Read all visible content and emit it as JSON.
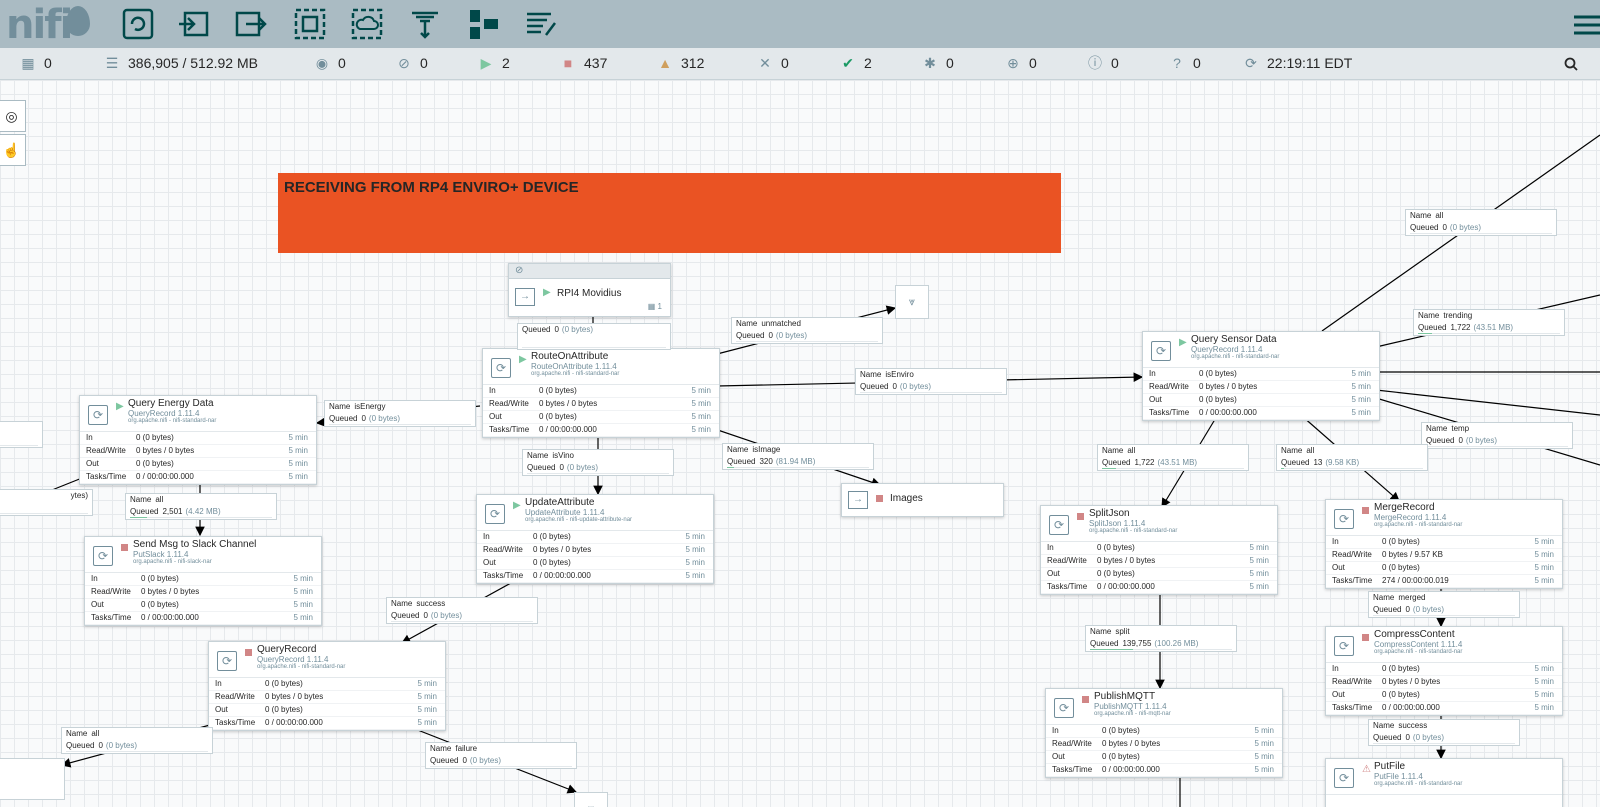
{
  "app": {
    "logo": "nifi"
  },
  "toolbar": {
    "items": [
      {
        "icon": "processor-icon"
      },
      {
        "icon": "input-port-icon"
      },
      {
        "icon": "output-port-icon"
      },
      {
        "icon": "process-group-icon"
      },
      {
        "icon": "remote-process-group-icon"
      },
      {
        "icon": "funnel-icon"
      },
      {
        "icon": "template-icon"
      },
      {
        "icon": "label-icon"
      }
    ]
  },
  "status": {
    "transmitting": "0",
    "queued": "386,905 / 512.92 MB",
    "transmitting_rpg": "0",
    "not_transmitting_rpg": "0",
    "running": "2",
    "stopped": "437",
    "invalid": "312",
    "disabled": "0",
    "up_to_date": "2",
    "locally_modified": "0",
    "stale": "0",
    "locally_modified_stale": "0",
    "sync_failure": "0",
    "refreshed": "22:19:11 EDT"
  },
  "label": {
    "text": "RECEIVING FROM RP4 ENVIRO+ DEVICE"
  },
  "process_group": {
    "name": "RPI4 Movidius",
    "count": "1"
  },
  "output_port": {
    "name": "Images"
  },
  "stats_labels": {
    "in": "In",
    "rw": "Read/Write",
    "out": "Out",
    "tasks": "Tasks/Time",
    "window": "5 min"
  },
  "processors": [
    {
      "name": "RouteOnAttribute",
      "type": "RouteOnAttribute 1.11.4",
      "bundle": "org.apache.nifi - nifi-standard-nar",
      "in": "0 (0 bytes)",
      "rw": "0 bytes / 0 bytes",
      "out": "0 (0 bytes)",
      "tasks": "0 / 00:00:00.000"
    },
    {
      "name": "Query Energy Data",
      "type": "QueryRecord 1.11.4",
      "bundle": "org.apache.nifi - nifi-standard-nar",
      "in": "0 (0 bytes)",
      "rw": "0 bytes / 0 bytes",
      "out": "0 (0 bytes)",
      "tasks": "0 / 00:00:00.000"
    },
    {
      "name": "UpdateAttribute",
      "type": "UpdateAttribute 1.11.4",
      "bundle": "org.apache.nifi - nifi-update-attribute-nar",
      "in": "0 (0 bytes)",
      "rw": "0 bytes / 0 bytes",
      "out": "0 (0 bytes)",
      "tasks": "0 / 00:00:00.000"
    },
    {
      "name": "Send Msg to Slack Channel",
      "type": "PutSlack 1.11.4",
      "bundle": "org.apache.nifi - nifi-slack-nar",
      "in": "0 (0 bytes)",
      "rw": "0 bytes / 0 bytes",
      "out": "0 (0 bytes)",
      "tasks": "0 / 00:00:00.000"
    },
    {
      "name": "QueryRecord",
      "type": "QueryRecord 1.11.4",
      "bundle": "org.apache.nifi - nifi-standard-nar",
      "in": "0 (0 bytes)",
      "rw": "0 bytes / 0 bytes",
      "out": "0 (0 bytes)",
      "tasks": "0 / 00:00:00.000"
    },
    {
      "name": "Query Sensor Data",
      "type": "QueryRecord 1.11.4",
      "bundle": "org.apache.nifi - nifi-standard-nar",
      "in": "0 (0 bytes)",
      "rw": "0 bytes / 0 bytes",
      "out": "0 (0 bytes)",
      "tasks": "0 / 00:00:00.000"
    },
    {
      "name": "SplitJson",
      "type": "SplitJson 1.11.4",
      "bundle": "org.apache.nifi - nifi-standard-nar",
      "in": "0 (0 bytes)",
      "rw": "0 bytes / 0 bytes",
      "out": "0 (0 bytes)",
      "tasks": "0 / 00:00:00.000"
    },
    {
      "name": "PublishMQTT",
      "type": "PublishMQTT 1.11.4",
      "bundle": "org.apache.nifi - nifi-mqtt-nar",
      "in": "0 (0 bytes)",
      "rw": "0 bytes / 0 bytes",
      "out": "0 (0 bytes)",
      "tasks": "0 / 00:00:00.000"
    },
    {
      "name": "MergeRecord",
      "type": "MergeRecord 1.11.4",
      "bundle": "org.apache.nifi - nifi-standard-nar",
      "in": "0 (0 bytes)",
      "rw": "0 bytes / 9.57 KB",
      "out": "0 (0 bytes)",
      "tasks": "274 / 00:00:00.019"
    },
    {
      "name": "CompressContent",
      "type": "CompressContent 1.11.4",
      "bundle": "org.apache.nifi - nifi-standard-nar",
      "in": "0 (0 bytes)",
      "rw": "0 bytes / 0 bytes",
      "out": "0 (0 bytes)",
      "tasks": "0 / 00:00:00.000"
    },
    {
      "name": "PutFile",
      "type": "PutFile 1.11.4",
      "bundle": "org.apache.nifi - nifi-standard-nar"
    }
  ],
  "connections": [
    {
      "name": "",
      "queued_count": "0",
      "queued_size": "(0 bytes)",
      "fill": 0
    },
    {
      "name": "unmatched",
      "queued_count": "0",
      "queued_size": "(0 bytes)",
      "fill": 0
    },
    {
      "name": "isEnviro",
      "queued_count": "0",
      "queued_size": "(0 bytes)",
      "fill": 0
    },
    {
      "name": "isEnergy",
      "queued_count": "0",
      "queued_size": "(0 bytes)",
      "fill": 0
    },
    {
      "name": "isVino",
      "queued_count": "0",
      "queued_size": "(0 bytes)",
      "fill": 0
    },
    {
      "name": "isImage",
      "queued_count": "320",
      "queued_size": "(81.94 MB)",
      "fill": 0.05
    },
    {
      "name": "all",
      "queued_count": "2,501",
      "queued_size": "(4.42 MB)",
      "fill": 0.12
    },
    {
      "name": "success",
      "queued_count": "0",
      "queued_size": "(0 bytes)",
      "fill": 0
    },
    {
      "name": "all",
      "queued_count": "0",
      "queued_size": "(0 bytes)",
      "fill": 0
    },
    {
      "name": "failure",
      "queued_count": "0",
      "queued_size": "(0 bytes)",
      "fill": 0
    },
    {
      "name": "all",
      "queued_count": "0",
      "queued_size": "(0 bytes)",
      "fill": 0
    },
    {
      "name": "trending",
      "queued_count": "1,722",
      "queued_size": "(43.51 MB)",
      "fill": 0.1
    },
    {
      "name": "temp",
      "queued_count": "0",
      "queued_size": "(0 bytes)",
      "fill": 0
    },
    {
      "name": "all",
      "queued_count": "1,722",
      "queued_size": "(43.51 MB)",
      "fill": 0.1
    },
    {
      "name": "all",
      "queued_count": "13",
      "queued_size": "(9.58 KB)",
      "fill": 0.02
    },
    {
      "name": "split",
      "queued_count": "139,755",
      "queued_size": "(100.26 MB)",
      "fill": 0.3
    },
    {
      "name": "merged",
      "queued_count": "0",
      "queued_size": "(0 bytes)",
      "fill": 0
    },
    {
      "name": "success",
      "queued_count": "0",
      "queued_size": "(0 bytes)",
      "fill": 0
    }
  ],
  "partial": {
    "bytes_fragment": "ytes)"
  },
  "colors": {
    "banner": "#ea5323",
    "running": "#7dc7a0",
    "stopped": "#d18686",
    "accent": "#728e9b"
  }
}
